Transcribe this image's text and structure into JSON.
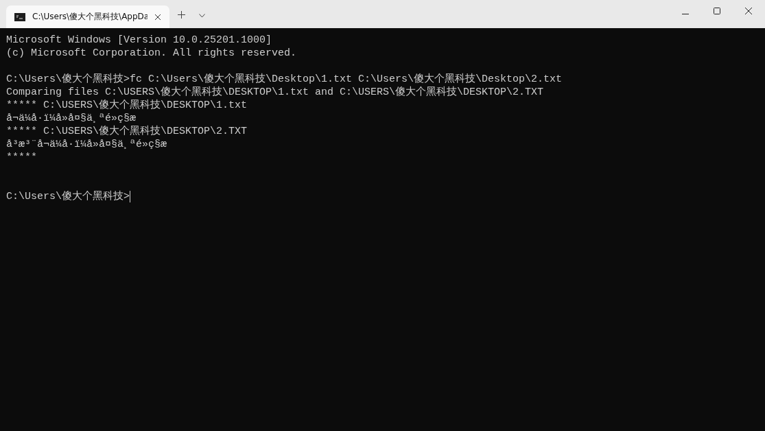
{
  "window": {
    "tab_title": "C:\\Users\\傻大个黑科技\\AppDa"
  },
  "console": {
    "blocks": [
      [
        "Microsoft Windows [Version 10.0.25201.1000]",
        "(c) Microsoft Corporation. All rights reserved."
      ],
      [
        "C:\\Users\\傻大个黑科技>fc C:\\Users\\傻大个黑科技\\Desktop\\1.txt C:\\Users\\傻大个黑科技\\Desktop\\2.txt",
        "Comparing files C:\\USERS\\傻大个黑科技\\DESKTOP\\1.txt and C:\\USERS\\傻大个黑科技\\DESKTOP\\2.TXT",
        "***** C:\\USERS\\傻大个黑科技\\DESKTOP\\1.txt",
        "å¬ä¼å·ï¼å»å¤§ä¸ªé»ç§æ",
        "***** C:\\USERS\\傻大个黑科技\\DESKTOP\\2.TXT",
        "å³æ³¨å¬ä¼å·ï¼å»å¤§ä¸ªé»ç§æ",
        "*****"
      ]
    ],
    "prompt": "C:\\Users\\傻大个黑科技>"
  }
}
